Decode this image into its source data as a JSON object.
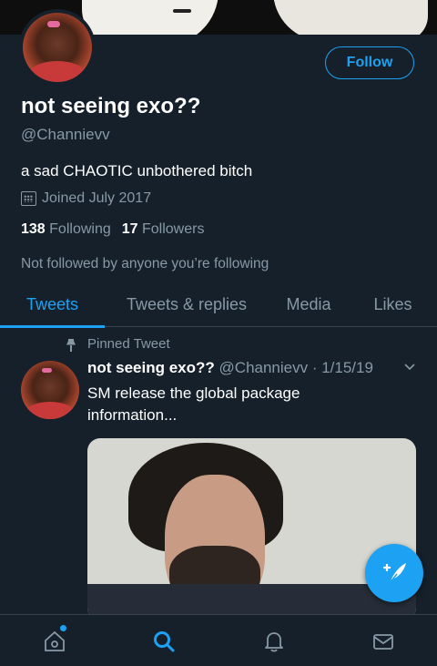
{
  "profile": {
    "name": "not seeing exo??",
    "handle": "@Channievv",
    "bio": "a sad CHAOTIC unbothered bitch",
    "joined": "Joined July 2017",
    "following_count": "138",
    "following_label": "Following",
    "followers_count": "17",
    "followers_label": "Followers",
    "not_followed_text": "Not followed by anyone you’re following",
    "follow_button": "Follow"
  },
  "tabs": [
    {
      "label": "Tweets",
      "active": true
    },
    {
      "label": "Tweets & replies",
      "active": false
    },
    {
      "label": "Media",
      "active": false
    },
    {
      "label": "Likes",
      "active": false
    }
  ],
  "tweet": {
    "pinned_label": "Pinned Tweet",
    "author_name": "not seeing exo??",
    "meta": "@Channievv · 1/15/19",
    "text": "SM release the global package information..."
  },
  "bottom_nav": [
    {
      "icon": "home-icon",
      "active": false
    },
    {
      "icon": "search-icon",
      "active": true
    },
    {
      "icon": "notifications-icon",
      "active": false
    },
    {
      "icon": "messages-icon",
      "active": false
    }
  ],
  "colors": {
    "background": "#15202b",
    "accent": "#1da1f2",
    "secondary_text": "#8899a6",
    "divider": "#38444d"
  }
}
